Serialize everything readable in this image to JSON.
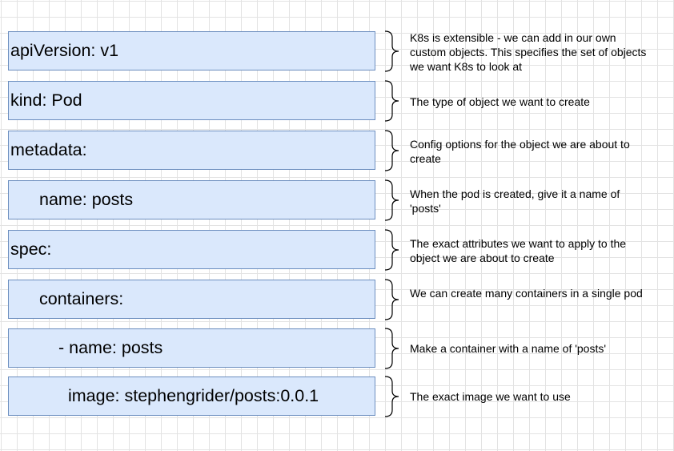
{
  "rows": [
    {
      "code": "apiVersion: v1",
      "note": "K8s is extensible - we can add in our own custom objects.  This specifies the set of objects we want K8s to look at"
    },
    {
      "code": "kind: Pod",
      "note": "The type of object we want to create"
    },
    {
      "code": "metadata:",
      "note": "Config options for the object we are about to create"
    },
    {
      "code": "name: posts",
      "note": "When the pod is created, give it a name of 'posts'"
    },
    {
      "code": "spec:",
      "note": "The exact attributes we want to apply to the object we are about to create"
    },
    {
      "code": "containers:",
      "note": "We can create many containers in a single pod"
    },
    {
      "code": "- name: posts",
      "note": "Make a container with a name of 'posts'"
    },
    {
      "code": "image: stephengrider/posts:0.0.1",
      "note": "The exact image we want to use"
    }
  ],
  "colors": {
    "box_fill": "#dae8fc",
    "box_border": "#6c8ebf",
    "brace": "#000000"
  }
}
